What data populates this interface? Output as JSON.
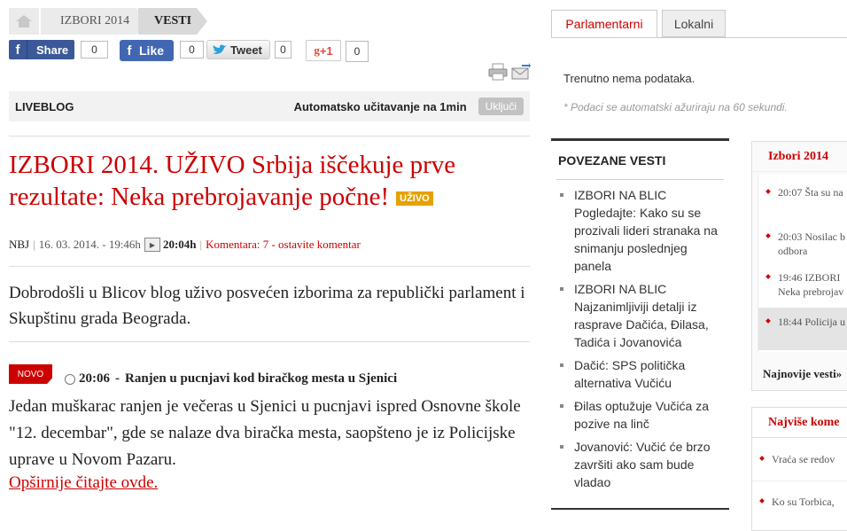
{
  "breadcrumb": {
    "home_icon": "home-icon",
    "level1": "IZBORI 2014",
    "level2": "VESTI"
  },
  "share": {
    "fb_share_label": "Share",
    "fb_share_count": "0",
    "fb_like_label": "Like",
    "fb_like_count": "0",
    "tweet_label": "Tweet",
    "tweet_count": "0",
    "gplus_label": "+1",
    "gplus_count": "0"
  },
  "tools": {
    "print_icon": "print-icon",
    "email_icon": "email-icon"
  },
  "liveblog": {
    "label": "LIVEBLOG",
    "auto_label": "Automatsko učitavanje na 1min",
    "toggle_label": "Uključi"
  },
  "article": {
    "headline": "IZBORI 2014. UŽIVO Srbija iščekuje prve rezultate: Neka prebrojavanje počne!",
    "live_badge": "UŽIVO",
    "author": "NBJ",
    "date": "16. 03. 2014. - 19:46h",
    "updated": "20:04h",
    "comments": "Komentara: 7 - ostavite komentar",
    "intro": "Dobrodošli u Blicov blog uživo posvećen izborima za republički parlament i Skupštinu grada Beograda."
  },
  "entry": {
    "badge": "NOVO",
    "time": "20:06",
    "dash": "-",
    "title": "Ranjen u pucnjavi kod biračkog mesta u Sjenici",
    "body": "Jedan muškarac ranjen je večeras u Sjenici u pucnjavi ispred Osnovne škole \"12. decembar\", gde se nalaze dva biračka mesta, saopšteno je iz Policijske uprave u Novom Pazaru.",
    "read_more": "Opširnije čitajte ovde."
  },
  "results_tabs": {
    "tab1": "Parlamentarni",
    "tab2": "Lokalni",
    "no_data": "Trenutno nema podataka.",
    "note": "* Podaci se automatski ažuriraju na 60 sekundi."
  },
  "related": {
    "title": "POVEZANE VESTI",
    "items": [
      "IZBORI NA BLIC Pogledajte: Kako su se prozivali lideri stranaka na snimanju poslednjeg panela",
      "IZBORI NA BLIC Najzanimljiviji detalji iz rasprave Dačića, Đilasa, Tadića i Jovanovića",
      "Dačić: SPS politička alternativa Vučiću",
      "Đilas optužuje Vučića za pozive na linč",
      "Jovanović: Vučić će brzo završiti ako sam bude vladao"
    ]
  },
  "news_box": {
    "title": "Izbori 2014",
    "items": [
      {
        "line1": "20:07 Šta su na",
        "line2": ""
      },
      {
        "line1": "20:03 Nosilac b",
        "line2": "odbora"
      },
      {
        "line1": "19:46 IZBORI",
        "line2": "Neka prebrojav"
      },
      {
        "line1": "18:44 Policija u",
        "line2": ""
      }
    ],
    "more": "Najnovije vesti»"
  },
  "comments_box": {
    "title": "Najviše kome",
    "items": [
      "Vraća se redov",
      "Ko su Torbica,"
    ]
  }
}
